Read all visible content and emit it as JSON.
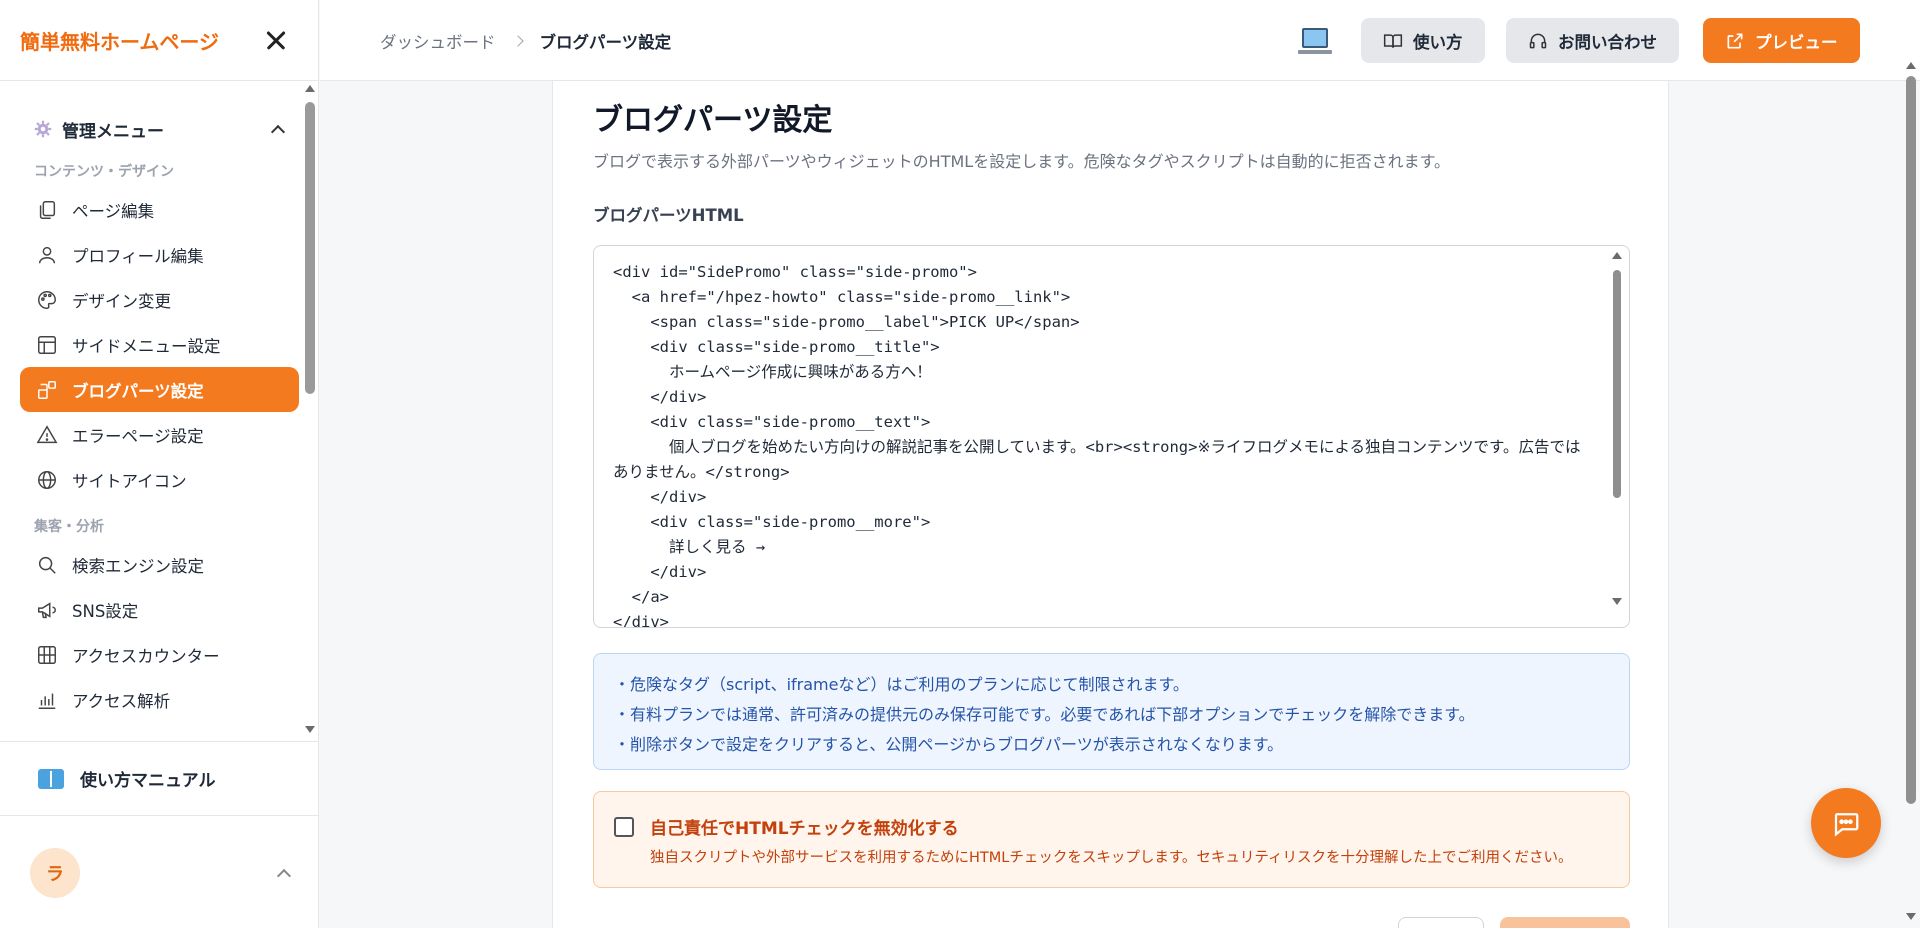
{
  "sidebar": {
    "brand": "簡単無料ホームページ",
    "menu_title": "管理メニュー",
    "section_content": "コンテンツ・デザイン",
    "section_analytics": "集客・分析",
    "items": [
      {
        "label": "ページ編集",
        "icon": "copy-icon"
      },
      {
        "label": "プロフィール編集",
        "icon": "user-icon"
      },
      {
        "label": "デザイン変更",
        "icon": "palette-icon"
      },
      {
        "label": "サイドメニュー設定",
        "icon": "layout-icon"
      },
      {
        "label": "ブログパーツ設定",
        "icon": "blocks-icon",
        "active": true
      },
      {
        "label": "エラーページ設定",
        "icon": "alert-triangle-icon"
      },
      {
        "label": "サイトアイコン",
        "icon": "globe-icon"
      },
      {
        "label": "検索エンジン設定",
        "icon": "search-icon"
      },
      {
        "label": "SNS設定",
        "icon": "megaphone-icon"
      },
      {
        "label": "アクセスカウンター",
        "icon": "grid-icon"
      },
      {
        "label": "アクセス解析",
        "icon": "bar-chart-icon"
      }
    ],
    "manual_label": "使い方マニュアル",
    "user_initial": "ラ"
  },
  "header": {
    "breadcrumb_root": "ダッシュボード",
    "breadcrumb_current": "ブログパーツ設定",
    "howto_label": "使い方",
    "contact_label": "お問い合わせ",
    "preview_label": "プレビュー"
  },
  "main": {
    "title": "ブログパーツ設定",
    "description": "ブログで表示する外部パーツやウィジェットのHTMLを設定します。危険なタグやスクリプトは自動的に拒否されます。",
    "field_label": "ブログパーツHTML",
    "code_value": "<div id=\"SidePromo\" class=\"side-promo\">\n  <a href=\"/hpez-howto\" class=\"side-promo__link\">\n    <span class=\"side-promo__label\">PICK UP</span>\n    <div class=\"side-promo__title\">\n      ホームページ作成に興味がある方へ！\n    </div>\n    <div class=\"side-promo__text\">\n      個人ブログを始めたい方向けの解説記事を公開しています。<br><strong>※ライフログメモによる独自コンテンツです。広告ではありません。</strong>\n    </div>\n    <div class=\"side-promo__more\">\n      詳しく見る →\n    </div>\n  </a>\n</div>",
    "info_lines": [
      "・危険なタグ（script、iframeなど）はご利用のプランに応じて制限されます。",
      "・有料プランでは通常、許可済みの提供元のみ保存可能です。必要であれば下部オプションでチェックを解除できます。",
      "・削除ボタンで設定をクリアすると、公開ページからブログパーツが表示されなくなります。"
    ],
    "warn_title": "自己責任でHTMLチェックを無効化する",
    "warn_desc": "独自スクリプトや外部サービスを利用するためにHTMLチェックをスキップします。セキュリティリスクを十分理解した上でご利用ください。",
    "warn_checked": false
  },
  "colors": {
    "accent": "#f47a1f",
    "brand": "#f06b0f",
    "info_text": "#2554a8",
    "warn_text": "#c2410c"
  }
}
